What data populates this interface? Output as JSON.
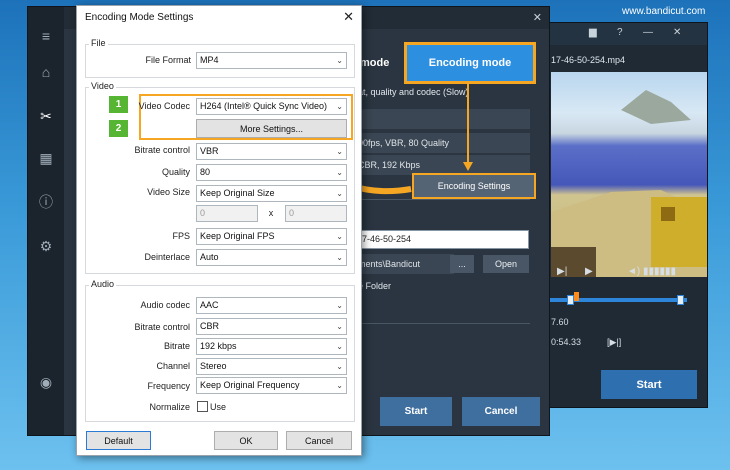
{
  "watermark": "www.bandicut.com",
  "video_window": {
    "filename": "17-46-50-254.mp4",
    "time_a": "7.60",
    "time_b": "0:54.33",
    "frame_btn": "[▶|]",
    "start_label": "Start",
    "playhead_position": 0.19
  },
  "main_window": {
    "close_glyph": "✕",
    "panel_title": "mode",
    "encoding_mode_label": "Encoding mode",
    "description": "at, quality and codec (Slow)",
    "row1": "00fps, VBR, 80 Quality",
    "row2": "CBR, 192 Kbps",
    "encoding_settings_label": "Encoding Settings",
    "filename_value": "7-46-50-254",
    "folder_path": "ments\\Bandicut",
    "browse_label": "...",
    "open_label": "Open",
    "folder_option": "e Folder",
    "start_label": "Start",
    "cancel_label": "Cancel"
  },
  "dialog": {
    "title": "Encoding Mode Settings",
    "close_glyph": "✕",
    "file_group": "File",
    "file_format_label": "File Format",
    "file_format_value": "MP4",
    "video_group": "Video",
    "video_codec_label": "Video Codec",
    "video_codec_value": "H264 (Intel® Quick Sync Video)",
    "more_settings_label": "More Settings...",
    "bitrate_control_label": "Bitrate control",
    "bitrate_control_value": "VBR",
    "quality_label": "Quality",
    "quality_value": "80",
    "video_size_label": "Video Size",
    "video_size_value": "Keep Original Size",
    "width_value": "0",
    "size_separator": "x",
    "height_value": "0",
    "fps_label": "FPS",
    "fps_value": "Keep Original FPS",
    "deinterlace_label": "Deinterlace",
    "deinterlace_value": "Auto",
    "audio_group": "Audio",
    "audio_codec_label": "Audio codec",
    "audio_codec_value": "AAC",
    "audio_bitrate_control_label": "Bitrate control",
    "audio_bitrate_control_value": "CBR",
    "bitrate_label": "Bitrate",
    "bitrate_value": "192 kbps",
    "channel_label": "Channel",
    "channel_value": "Stereo",
    "frequency_label": "Frequency",
    "frequency_value": "Keep Original Frequency",
    "normalize_label": "Normalize",
    "normalize_use_label": "Use",
    "normalize_checked": false,
    "default_button": "Default",
    "ok_button": "OK",
    "cancel_button": "Cancel",
    "step1": "1",
    "step2": "2"
  },
  "colors": {
    "callout": "#f5a623",
    "step_badge": "#56b532",
    "accent_blue": "#2d8fe0"
  }
}
